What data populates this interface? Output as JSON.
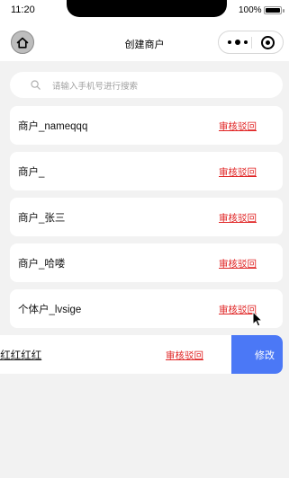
{
  "status_bar": {
    "time": "11:20",
    "battery_percent": "100%",
    "battery_level": 1.0
  },
  "nav": {
    "title": "创建商户"
  },
  "search": {
    "placeholder": "请输入手机号进行搜索"
  },
  "merchants": [
    {
      "name": "商户_nameqqq",
      "status": "审核驳回"
    },
    {
      "name": "商户_",
      "status": "审核驳回"
    },
    {
      "name": "商户_张三",
      "status": "审核驳回"
    },
    {
      "name": "商户_哈喽",
      "status": "审核驳回"
    },
    {
      "name": "个体户_lvsige",
      "status": "审核驳回"
    }
  ],
  "swiped_merchant": {
    "name": "I红红红红",
    "status": "审核驳回",
    "action_label": "修改"
  },
  "colors": {
    "status_red": "#e02424",
    "edit_blue": "#4b78f6",
    "page_bg": "#f2f2f2"
  },
  "icons": [
    "home-icon",
    "more-dots-icon",
    "close-mini-program-icon",
    "search-icon",
    "mouse-cursor-icon"
  ]
}
